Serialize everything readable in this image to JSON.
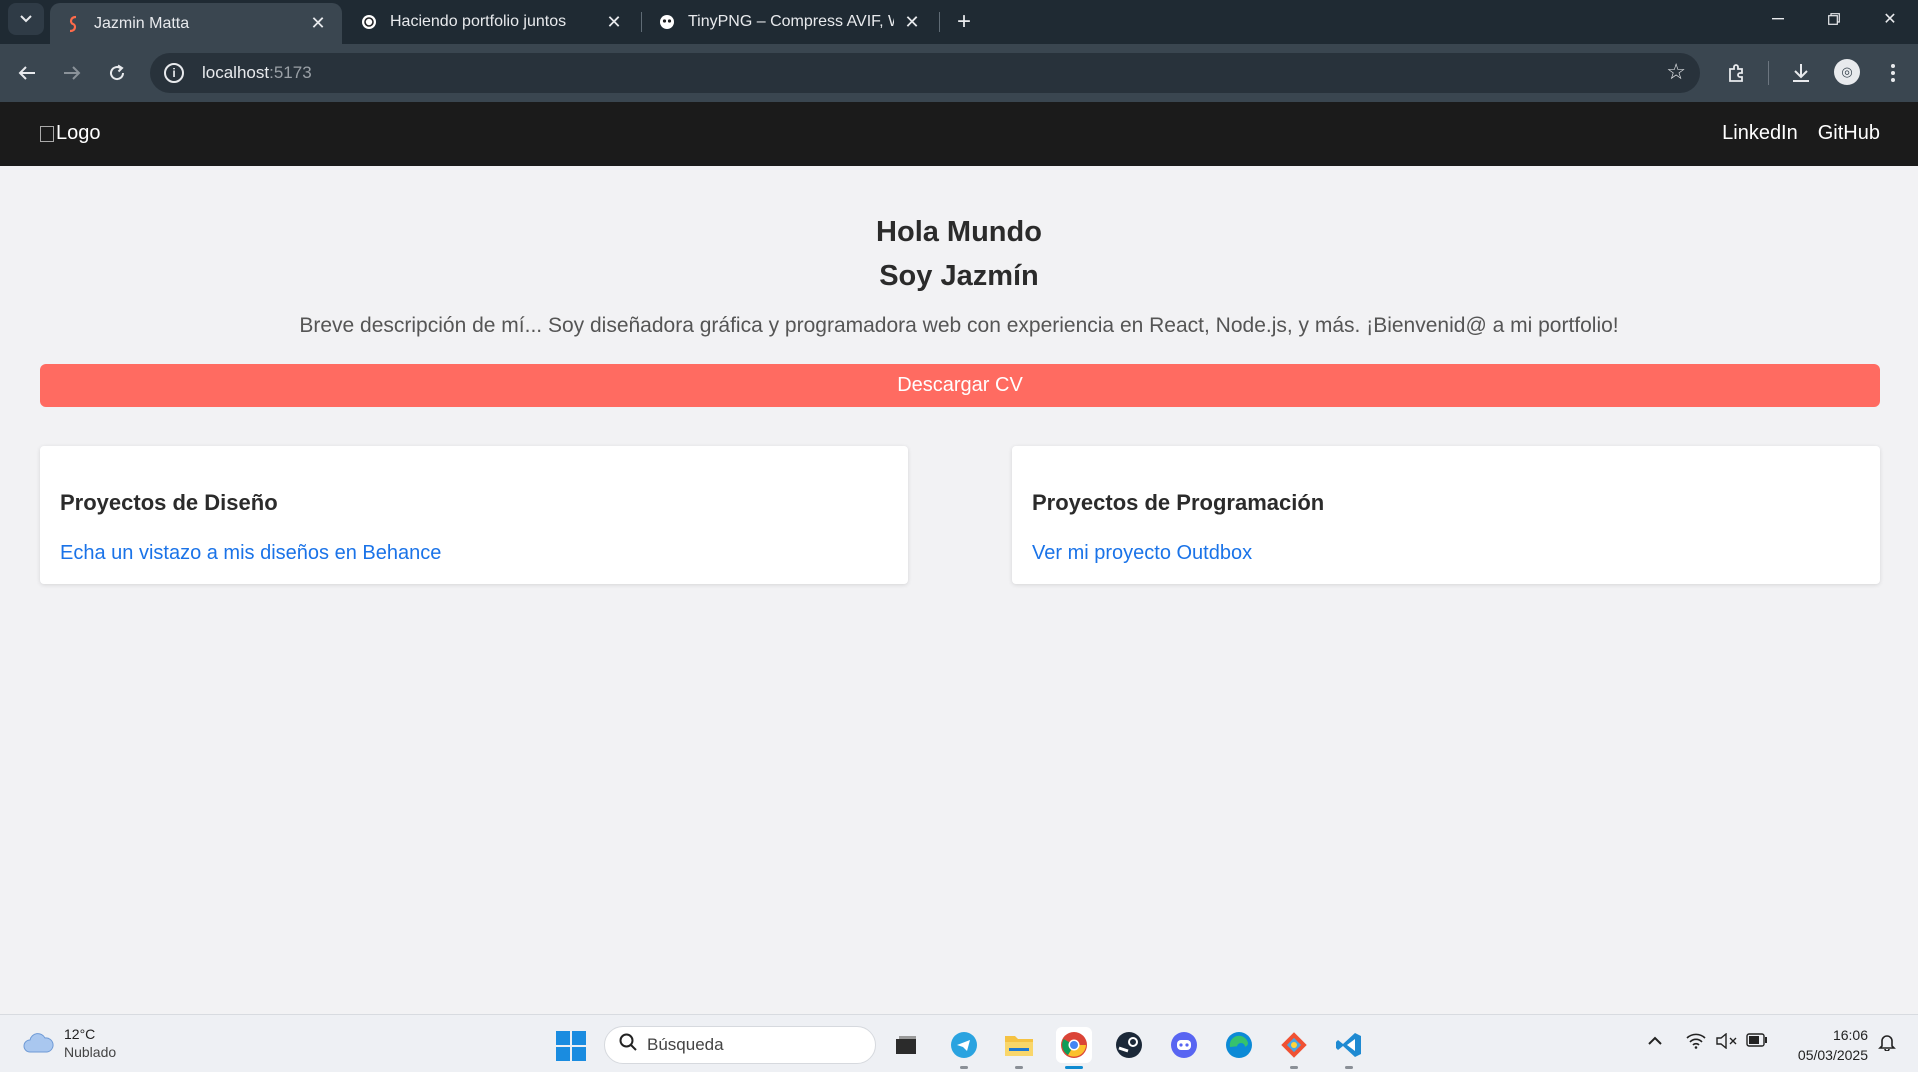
{
  "browser": {
    "tabs": [
      {
        "title": "Jazmin Matta",
        "favicon": "s-logo-icon",
        "active": true
      },
      {
        "title": "Haciendo portfolio juntos",
        "favicon": "chatgpt-icon",
        "active": false
      },
      {
        "title": "TinyPNG – Compress AVIF, Web",
        "favicon": "panda-icon",
        "active": false
      }
    ],
    "new_tab": "+",
    "url_host": "localhost",
    "url_port": ":5173"
  },
  "site": {
    "logo_alt": "Logo",
    "nav": {
      "linkedin": "LinkedIn",
      "github": "GitHub"
    },
    "hero": {
      "line1": "Hola Mundo",
      "line2": "Soy Jazmín",
      "description": "Breve descripción de mí... Soy diseñadora gráfica y programadora web con experiencia en React, Node.js, y más. ¡Bienvenid@ a mi portfolio!"
    },
    "cv_button": "Descargar CV",
    "cards": [
      {
        "title": "Proyectos de Diseño",
        "link": "Echa un vistazo a mis diseños en Behance"
      },
      {
        "title": "Proyectos de Programación",
        "link": "Ver mi proyecto Outdbox"
      }
    ],
    "colors": {
      "nav_bg": "#1b1b1b",
      "button": "#ff6b61",
      "link": "#1a73e8",
      "page_bg": "#f2f2f4"
    }
  },
  "taskbar": {
    "weather": {
      "temp": "12°C",
      "condition": "Nublado"
    },
    "search_placeholder": "Búsqueda",
    "clock": {
      "time": "16:06",
      "date": "05/03/2025"
    }
  }
}
